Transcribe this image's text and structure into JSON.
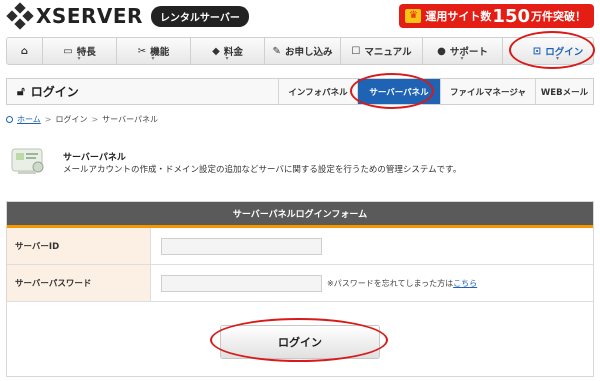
{
  "logo": {
    "text": "XSERVER",
    "sub": "レンタルサーバー"
  },
  "banner": {
    "pre": "運用サイト数",
    "num": "150",
    "post": "万件突破！"
  },
  "nav": [
    {
      "label": "",
      "icon": "home-icon",
      "glyph": "⌂"
    },
    {
      "label": "特長",
      "icon": "monitor-icon",
      "glyph": "▭"
    },
    {
      "label": "機能",
      "icon": "tools-icon",
      "glyph": "✂"
    },
    {
      "label": "料金",
      "icon": "tag-icon",
      "glyph": "◆"
    },
    {
      "label": "お申し込み",
      "icon": "pencil-icon",
      "glyph": "✎"
    },
    {
      "label": "マニュアル",
      "icon": "book-icon",
      "glyph": "☐"
    },
    {
      "label": "サポート",
      "icon": "user-icon",
      "glyph": "●"
    },
    {
      "label": "ログイン",
      "icon": "lock-icon",
      "glyph": "⊡"
    }
  ],
  "subbar": {
    "title": "ログイン",
    "tabs": [
      "インフォパネル",
      "サーバーパネル",
      "ファイルマネージャ",
      "WEBメール"
    ]
  },
  "breadcrumb": [
    "ホーム",
    "ログイン",
    "サーバーパネル"
  ],
  "intro": {
    "title": "サーバーパネル",
    "desc": "メールアカウントの作成・ドメイン設定の追加などサーバに関する設定を行うための管理システムです。"
  },
  "form": {
    "title": "サーバーパネルログインフォーム",
    "id_label": "サーバーID",
    "id_value": "",
    "pw_label": "サーバーパスワード",
    "pw_value": "",
    "pw_note": "※パスワードを忘れてしまった方は",
    "pw_link": "こちら",
    "button": "ログイン"
  },
  "colors": {
    "accent": "#1e63b4",
    "form_line": "#f39800",
    "highlight": "#d81a1a",
    "banner": "#e41e14"
  }
}
